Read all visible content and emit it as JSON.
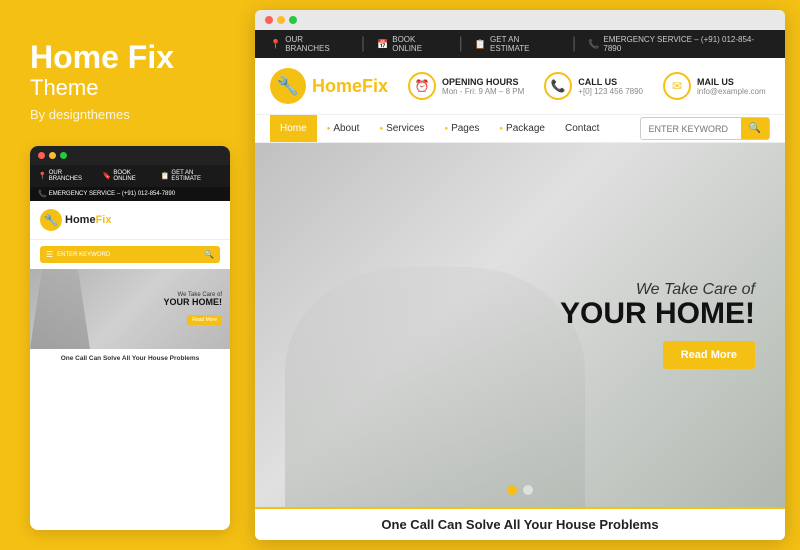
{
  "brand": {
    "title": "Home Fix",
    "subtitle": "Theme",
    "by": "By designthemes"
  },
  "topbar": {
    "item1": "OUR BRANCHES",
    "item2": "BOOK ONLINE",
    "item3": "GET AN ESTIMATE",
    "item4": "EMERGENCY SERVICE – (+91) 012-854-7890"
  },
  "header": {
    "logo_text1": "Home",
    "logo_text2": "Fix",
    "info1_label": "OPENING HOURS",
    "info1_value": "Mon - Fri: 9 AM – 8 PM",
    "info2_label": "CALL US",
    "info2_value": "+[0] 123 456 7890",
    "info3_label": "MAIL US",
    "info3_value": "info@example.com"
  },
  "nav": {
    "items": [
      {
        "label": "Home",
        "active": true
      },
      {
        "label": "About",
        "active": false
      },
      {
        "label": "Services",
        "active": false
      },
      {
        "label": "Pages",
        "active": false
      },
      {
        "label": "Package",
        "active": false
      },
      {
        "label": "Contact",
        "active": false
      }
    ],
    "search_placeholder": "ENTER KEYWORD"
  },
  "hero": {
    "line1": "We Take Care of",
    "line2": "YOUR HOME!",
    "button": "Read More"
  },
  "bottom": {
    "text": "One Call Can Solve All Your House Problems"
  },
  "mini": {
    "hero_line1": "We Take Care of",
    "hero_line2": "YOUR HOME!",
    "read_more": "Read More",
    "footer_text": "One Call Can Solve All Your House Problems",
    "search_placeholder": "ENTER KEYWORD"
  }
}
